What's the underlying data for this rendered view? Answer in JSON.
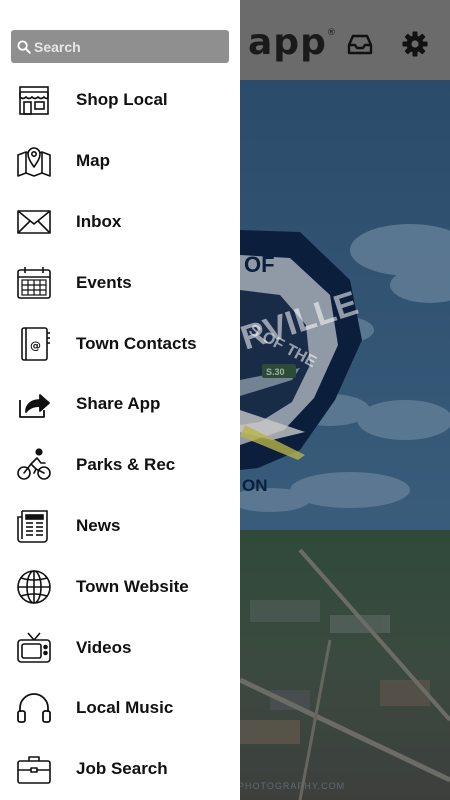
{
  "search": {
    "placeholder": "Search",
    "value": ""
  },
  "header": {
    "logo_text": "app",
    "logo_mark": "®",
    "inbox_icon": "tray-icon",
    "settings_icon": "gear-icon"
  },
  "menu": {
    "items": [
      {
        "label": "Shop Local",
        "icon": "storefront-icon"
      },
      {
        "label": "Map",
        "icon": "map-pin-icon"
      },
      {
        "label": "Inbox",
        "icon": "envelope-icon"
      },
      {
        "label": "Events",
        "icon": "calendar-icon"
      },
      {
        "label": "Town Contacts",
        "icon": "address-book-icon"
      },
      {
        "label": "Share App",
        "icon": "share-icon"
      },
      {
        "label": "Parks & Rec",
        "icon": "cyclist-icon"
      },
      {
        "label": "News",
        "icon": "newspaper-icon"
      },
      {
        "label": "Town Website",
        "icon": "globe-icon"
      },
      {
        "label": "Videos",
        "icon": "tv-icon"
      },
      {
        "label": "Local Music",
        "icon": "headphones-icon"
      },
      {
        "label": "Job Search",
        "icon": "briefcase-icon"
      }
    ]
  },
  "hero": {
    "seal_text_top": "OF",
    "seal_text_name": "RVILLE",
    "seal_text_motto": "S OF THE",
    "seal_text_bottom": "ON",
    "seal_route": "S.30",
    "photo_credit": "PHOTOGRAPHY.COM"
  },
  "colors": {
    "drawer_bg": "#ffffff",
    "search_bg": "#8f8f8f",
    "header_dimmed": "#6b6b6b",
    "seal_navy": "#0b1f3d",
    "sky_dimmed": "#2c4a66"
  }
}
